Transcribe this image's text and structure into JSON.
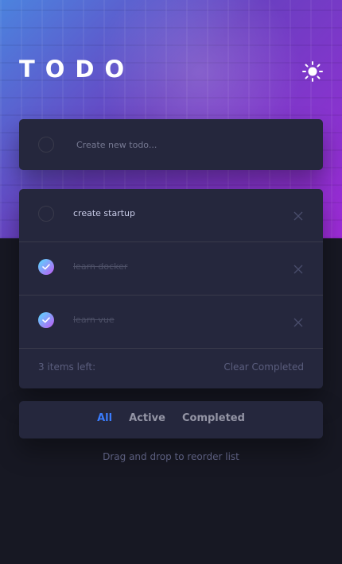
{
  "app": {
    "title": "TODO",
    "theme_icon": "sun-icon"
  },
  "new_todo": {
    "placeholder": "Create new todo..."
  },
  "todos": [
    {
      "text": "create startup",
      "completed": false
    },
    {
      "text": "learn docker",
      "completed": true
    },
    {
      "text": "learn vue",
      "completed": true
    }
  ],
  "footer": {
    "items_left": "3 items left:",
    "clear_label": "Clear Completed"
  },
  "filters": {
    "all": "All",
    "active": "Active",
    "completed": "Completed",
    "selected": "All"
  },
  "hint": "Drag and drop to reorder list",
  "colors": {
    "accent": "#3a7cfd",
    "check_gradient_start": "#55ddff",
    "check_gradient_end": "#c058f3",
    "card": "#25273d",
    "background": "#171823"
  }
}
